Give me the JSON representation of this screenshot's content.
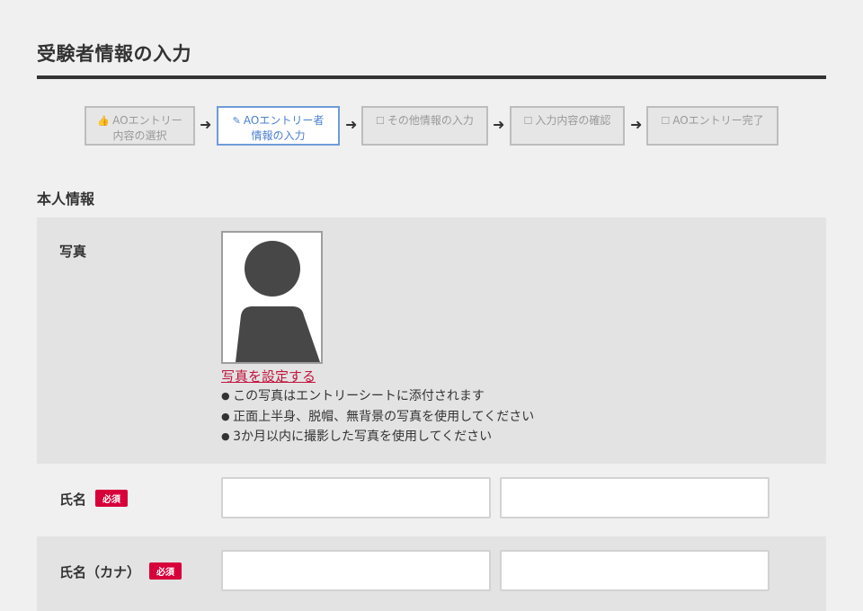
{
  "header": {
    "title": "受験者情報の入力"
  },
  "steps": [
    {
      "icon": "thumbs-up-icon",
      "glyph": "👍",
      "label": "AOエントリー\n内容の選択",
      "state": "done"
    },
    {
      "icon": "edit-icon",
      "glyph": "✎",
      "label": "AOエントリー者\n情報の入力",
      "state": "active"
    },
    {
      "icon": "checkbox-icon",
      "glyph": "☐",
      "label": "その他情報の入力",
      "state": "pending"
    },
    {
      "icon": "checkbox-icon",
      "glyph": "☐",
      "label": "入力内容の確認",
      "state": "pending"
    },
    {
      "icon": "checkbox-icon",
      "glyph": "☐",
      "label": "AOエントリー完了",
      "state": "pending"
    }
  ],
  "section": {
    "title": "本人情報"
  },
  "photo": {
    "label": "写真",
    "link_text": "写真を設定する",
    "notes": [
      "この写真はエントリーシートに添付されます",
      "正面上半身、脱帽、無背景の写真を使用してください",
      "3か月以内に撮影した写真を使用してください"
    ]
  },
  "name": {
    "label": "氏名",
    "required": "必須",
    "last_value": "",
    "first_value": ""
  },
  "name_kana": {
    "label": "氏名（カナ）",
    "required": "必須",
    "last_value": "",
    "first_value": ""
  },
  "colors": {
    "accent_red": "#d7003a",
    "link_red": "#c0143c",
    "active_blue": "#6f9bd8"
  }
}
